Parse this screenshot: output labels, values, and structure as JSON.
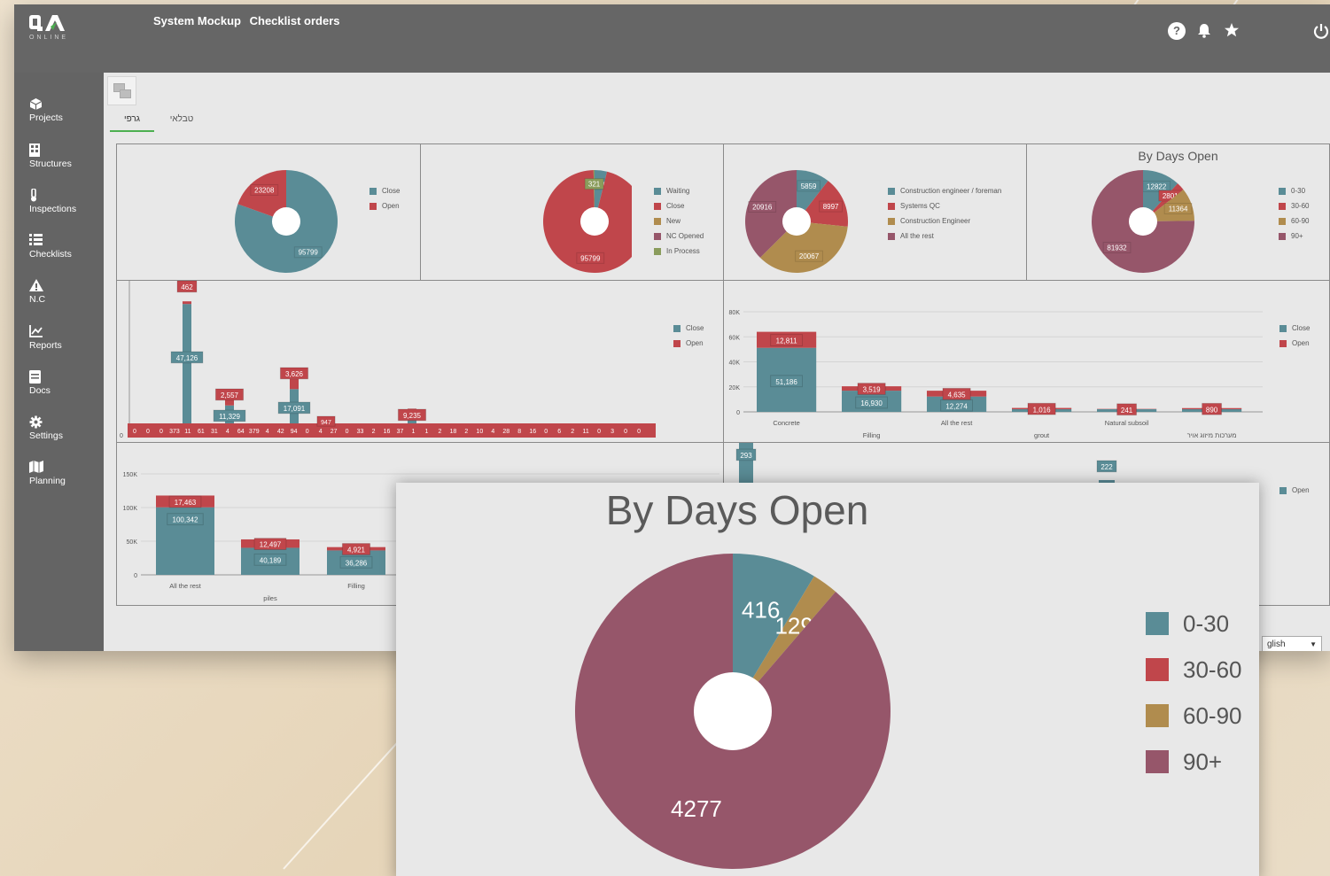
{
  "app": {
    "logo_text": "QA",
    "logo_sub": "ONLINE",
    "breadcrumb": [
      "System Mockup",
      "Checklist orders"
    ],
    "icons": [
      "help-icon",
      "bell-icon",
      "star-icon",
      "power-icon"
    ],
    "help_glyph": "?",
    "language": "glish"
  },
  "sidebar": {
    "items": [
      {
        "label": "Projects",
        "icon": "cube-icon"
      },
      {
        "label": "Structures",
        "icon": "building-icon"
      },
      {
        "label": "Inspections",
        "icon": "thermometer-icon"
      },
      {
        "label": "Checklists",
        "icon": "list-icon"
      },
      {
        "label": "N.C",
        "icon": "warning-icon"
      },
      {
        "label": "Reports",
        "icon": "chart-line-icon"
      },
      {
        "label": "Docs",
        "icon": "document-icon"
      },
      {
        "label": "Settings",
        "icon": "gear-icon"
      },
      {
        "label": "Planning",
        "icon": "map-icon"
      }
    ]
  },
  "tabs": [
    "גרפי",
    "טבלאי"
  ],
  "colors": {
    "teal": "#5a8c96",
    "red": "#c0464b",
    "olive": "#b08c4e",
    "green": "#8a9c5c",
    "plum": "#96566a",
    "gray": "#8c8c8c"
  },
  "chart_data": [
    {
      "type": "pie",
      "title": "",
      "labels": [
        "Close",
        "Open"
      ],
      "values": [
        95799,
        23208
      ]
    },
    {
      "type": "pie",
      "title": "",
      "labels": [
        "Waiting",
        "Close",
        "New",
        "NC Opened",
        "In Process"
      ],
      "values": [
        3900,
        95799,
        0,
        0,
        321
      ]
    },
    {
      "type": "pie",
      "title": "",
      "labels": [
        "Construction engineer / foreman",
        "Systems QC",
        "Construction Engineer",
        "All the rest"
      ],
      "values": [
        5859,
        8997,
        20067,
        20916
      ]
    },
    {
      "type": "pie",
      "title": "By Days Open",
      "labels": [
        "0-30",
        "30-60",
        "60-90",
        "90+"
      ],
      "values": [
        12822,
        2801,
        11364,
        81932
      ]
    },
    {
      "type": "bar",
      "title": "",
      "stacked": true,
      "legend": [
        "Close",
        "Open"
      ],
      "close": [
        47126,
        11329,
        17091,
        9235
      ],
      "open": [
        462,
        2557,
        3626,
        947
      ],
      "bottom_labels": [
        "0",
        "0",
        "0",
        "373",
        "11",
        "61",
        "31",
        "4",
        "64",
        "379",
        "4",
        "42",
        "94",
        "0",
        "4",
        "27",
        "0",
        "33",
        "2",
        "16",
        "37",
        "1",
        "1",
        "2",
        "18",
        "2",
        "10",
        "4",
        "28",
        "8",
        "16",
        "0",
        "6",
        "2",
        "11",
        "0",
        "3",
        "0",
        "0"
      ]
    },
    {
      "type": "bar",
      "title": "",
      "stacked": true,
      "legend": [
        "Close",
        "Open"
      ],
      "categories": [
        "Concrete",
        "Filling",
        "All the rest",
        "grout",
        "Natural subsoil",
        "מערכות מיזוג אויר"
      ],
      "close": [
        51186,
        16930,
        12274,
        0,
        0,
        0
      ],
      "open": [
        12811,
        3519,
        4635,
        1016,
        241,
        890
      ],
      "ylim": [
        0,
        80000
      ],
      "yticks": [
        "0",
        "20K",
        "40K",
        "60K",
        "80K"
      ]
    },
    {
      "type": "bar",
      "title": "",
      "stacked": true,
      "categories": [
        "All the rest",
        "piles",
        "Filling"
      ],
      "close": [
        100342,
        40189,
        36286
      ],
      "open": [
        17463,
        12497,
        4921
      ],
      "ylim": [
        0,
        150000
      ],
      "yticks": [
        "0",
        "50K",
        "100K",
        "150K"
      ]
    },
    {
      "type": "bar",
      "title": "",
      "legend": [
        "Open"
      ],
      "values": [
        293,
        222
      ]
    },
    {
      "type": "pie",
      "title": "By Days Open",
      "labels": [
        "0-30",
        "30-60",
        "60-90",
        "90+"
      ],
      "values": [
        416,
        129,
        4277
      ]
    }
  ]
}
